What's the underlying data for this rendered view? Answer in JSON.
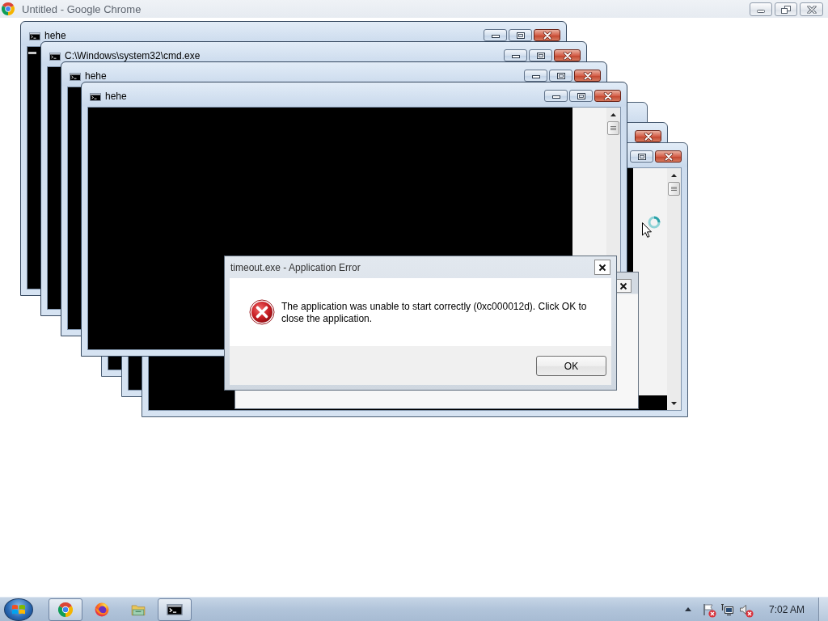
{
  "browser_window": {
    "title": "Untitled - Google Chrome"
  },
  "console_windows": [
    {
      "kind": "window",
      "title": "hehe",
      "cursor": true
    },
    {
      "kind": "window",
      "title": "C:\\Windows\\system32\\cmd.exe",
      "cursor": false
    },
    {
      "kind": "window",
      "title": "hehe",
      "cursor": false
    },
    {
      "kind": "window",
      "title": "hehe",
      "cursor": false
    },
    {
      "kind": "ghost"
    },
    {
      "kind": "ghost"
    },
    {
      "kind": "ghost"
    }
  ],
  "error_dialog": {
    "title": "timeout.exe - Application Error",
    "message": "The application was unable to start correctly (0xc000012d). Click OK to close the application.",
    "button": "OK"
  },
  "taskbar": {
    "buttons": [
      {
        "kind": "chrome",
        "running": true
      },
      {
        "kind": "firefox",
        "running": false
      },
      {
        "kind": "folder",
        "running": false
      },
      {
        "kind": "console",
        "running": true
      }
    ],
    "tray": {
      "action_center_alert": true,
      "volume_muted": true,
      "clock": "7:02 AM"
    }
  }
}
